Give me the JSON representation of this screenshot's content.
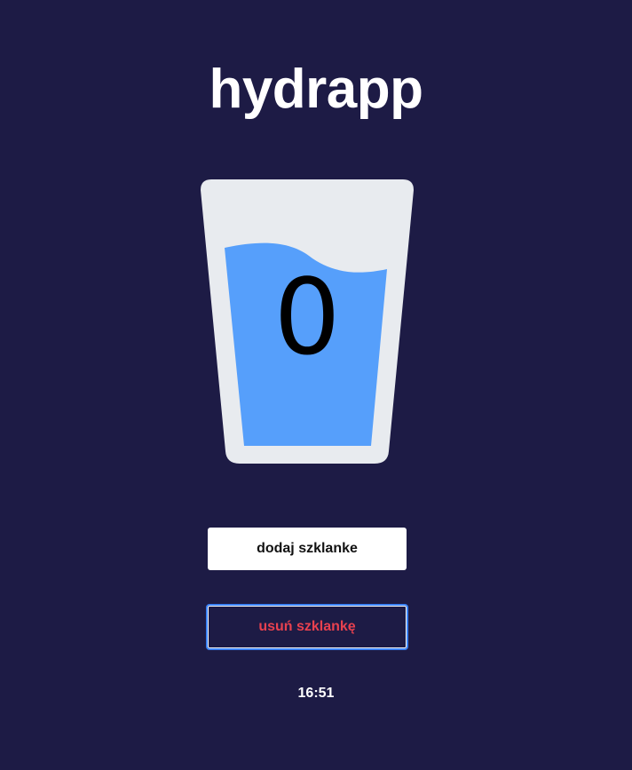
{
  "app": {
    "title": "hydrapp"
  },
  "glass": {
    "count": "0",
    "water_level": 0.7,
    "glass_color": "#e8ebef",
    "water_color": "#569ffb"
  },
  "actions": {
    "add_label": "dodaj szklanke",
    "remove_label": "usuń szklankę"
  },
  "status": {
    "time": "16:51"
  },
  "colors": {
    "background": "#1d1b45",
    "remove_text": "#e8414f",
    "focus_ring": "#3b82f6"
  }
}
